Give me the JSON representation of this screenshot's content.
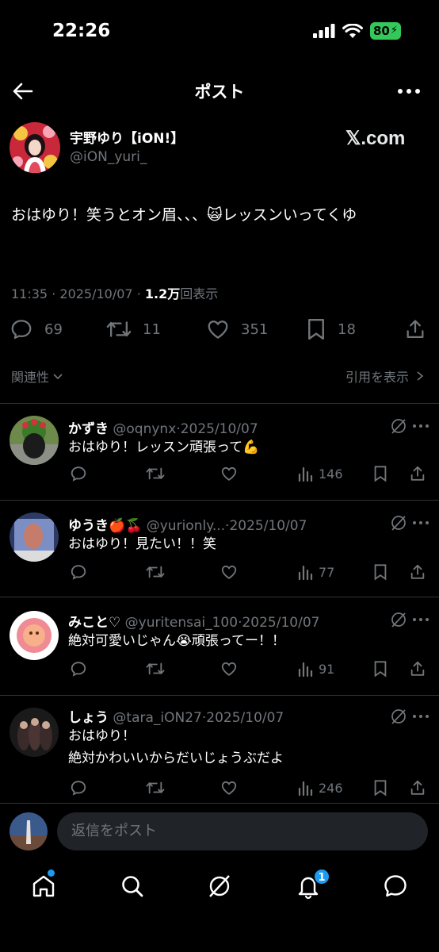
{
  "status_bar": {
    "time": "22:26",
    "battery": "80"
  },
  "header": {
    "title": "ポスト"
  },
  "post": {
    "author_name": "宇野ゆり【iON!】",
    "author_handle": "@iON_yuri_",
    "watermark": "𝕏.com",
    "text": "おはゆり！笑うとオン眉、、、🙀レッスンいってくゆ",
    "time": "11:35",
    "date": "2025/10/07",
    "views_count": "1.2万",
    "views_label": "回表示",
    "separator": "·",
    "reply_count": "69",
    "repost_count": "11",
    "like_count": "351",
    "bookmark_count": "18"
  },
  "sort": {
    "relevance": "関連性",
    "quotes": "引用を表示"
  },
  "replies": [
    {
      "name": "かずき",
      "handle": "@oqnynx",
      "sep": "·",
      "date": "2025/10/07",
      "text": "おはゆり！レッスン頑張って💪",
      "views": "146"
    },
    {
      "name": "ゆうき🍎🍒",
      "handle": "@yurionly...",
      "sep": "·",
      "date": "2025/10/07",
      "text": "おはゆり！見たい！！笑",
      "views": "77"
    },
    {
      "name": "みこと♡",
      "handle": "@yuritensai_100",
      "sep": "·",
      "date": "2025/10/07",
      "text": "絶対可愛いじゃん😭頑張ってー！！",
      "views": "91"
    },
    {
      "name": "しょう",
      "handle": "@tara_iON27",
      "sep": "·",
      "date": "2025/10/07",
      "text_line1": "おはゆり！",
      "text_line2": "絶対かわいいからだいじょうぶだよ",
      "views": "246"
    }
  ],
  "composer": {
    "placeholder": "返信をポスト"
  },
  "tabbar": {
    "notification_badge": "1"
  },
  "colors": {
    "accent": "#1d9bf0",
    "muted": "#71767b",
    "battery": "#34c759",
    "background": "#000000"
  }
}
